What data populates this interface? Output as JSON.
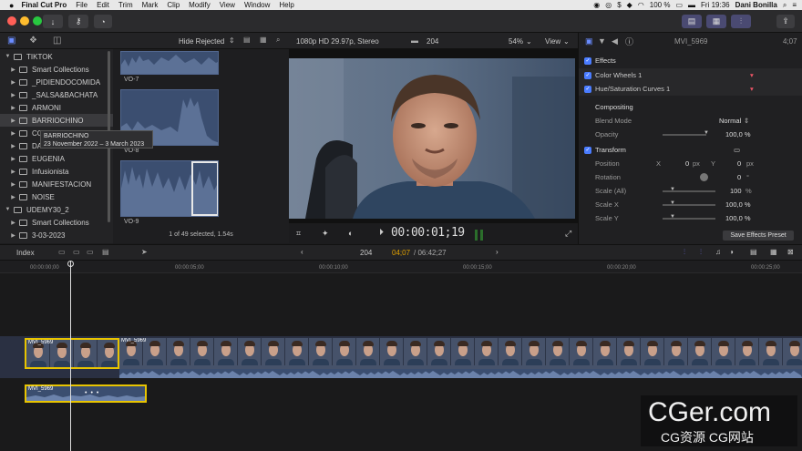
{
  "menubar": {
    "app": "Final Cut Pro",
    "items": [
      "File",
      "Edit",
      "Trim",
      "Mark",
      "Clip",
      "Modify",
      "View",
      "Window",
      "Help"
    ],
    "battery": "100 %",
    "clock": "Fri 19:36",
    "user": "Dani Bonilla"
  },
  "browser_header": {
    "filter": "Hide Rejected"
  },
  "library": {
    "items": [
      {
        "label": "TIKTOK",
        "kind": "library",
        "expanded": true
      },
      {
        "label": "Smart Collections",
        "kind": "folder"
      },
      {
        "label": "_PIDIENDOCOMIDA",
        "kind": "event"
      },
      {
        "label": "_SALSA&BACHATA",
        "kind": "event"
      },
      {
        "label": "ARMONI",
        "kind": "event"
      },
      {
        "label": "BARRIOCHINO",
        "kind": "event",
        "selected": true
      },
      {
        "label": "CC",
        "kind": "event"
      },
      {
        "label": "DA",
        "kind": "event"
      },
      {
        "label": "EUGENIA",
        "kind": "event"
      },
      {
        "label": "Infusionista",
        "kind": "event"
      },
      {
        "label": "MANIFESTACION",
        "kind": "event"
      },
      {
        "label": "NOISE",
        "kind": "event"
      },
      {
        "label": "UDEMY30_2",
        "kind": "library",
        "expanded": true
      },
      {
        "label": "Smart Collections",
        "kind": "folder"
      },
      {
        "label": "3-03-2023",
        "kind": "event"
      }
    ],
    "tooltip": {
      "title": "BARRIOCHINO",
      "range": "23 November 2022 – 3 March 2023"
    }
  },
  "browser": {
    "clips": [
      {
        "name": "VO-7"
      },
      {
        "name": "VO-8"
      },
      {
        "name": "VO-9"
      }
    ],
    "status": "1 of 49 selected, 1.54s"
  },
  "viewer": {
    "format": "1080p HD 29.97p, Stereo",
    "clip_count": "204",
    "zoom": "54%",
    "view_menu": "View",
    "timecode": "00:00:01;19"
  },
  "inspector": {
    "clip_name": "MVI_5969",
    "duration": "4;07",
    "effects_title": "Effects",
    "effects": [
      "Color Wheels 1",
      "Hue/Saturation Curves 1"
    ],
    "compositing": "Compositing",
    "blend_mode_label": "Blend Mode",
    "blend_mode": "Normal",
    "opacity_label": "Opacity",
    "opacity": "100,0 %",
    "transform": "Transform",
    "position_label": "Position",
    "pos_x_label": "X",
    "pos_x": "0",
    "pos_x_unit": "px",
    "pos_y_label": "Y",
    "pos_y": "0",
    "pos_y_unit": "px",
    "rotation_label": "Rotation",
    "rotation": "0",
    "rotation_unit": "°",
    "scale_all_label": "Scale (All)",
    "scale_all": "100",
    "scale_all_unit": "%",
    "scale_x_label": "Scale X",
    "scale_x": "100,0 %",
    "scale_y_label": "Scale Y",
    "scale_y": "100,0 %",
    "save_preset": "Save Effects Preset"
  },
  "timeline_header": {
    "index": "Index",
    "project_count": "204",
    "position": "04;07",
    "duration": "/ 06:42;27"
  },
  "ruler": {
    "ticks": [
      "00:00:00;00",
      "00:00:05;00",
      "00:00:10;00",
      "00:00:15;00",
      "00:00:20;00",
      "00:00:25;00"
    ]
  },
  "timeline": {
    "clip_a": "MVI_5969",
    "clip_b": "MVI_5969",
    "audio_clip": "MVI_5969"
  },
  "watermark": {
    "brand": "CGer.com",
    "sub": "CG资源 CG网站"
  },
  "colors": {
    "accent": "#4a7cff",
    "selection": "#e8c400",
    "waveform": "#3b4e70"
  }
}
